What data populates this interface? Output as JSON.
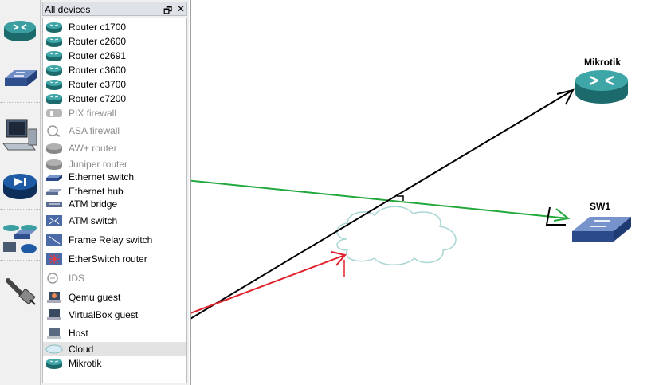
{
  "dock": {
    "title": "All devices",
    "float_glyph": "🗗",
    "close_glyph": "✕"
  },
  "toolbar": {
    "tools": [
      {
        "name": "routers-tool",
        "icon": "router-icon"
      },
      {
        "name": "switches-tool",
        "icon": "switch-icon"
      },
      {
        "name": "end-devices-tool",
        "icon": "computer-icon"
      },
      {
        "name": "security-devices-tool",
        "icon": "firewall-icon"
      },
      {
        "name": "all-devices-tool",
        "icon": "devices-group-icon"
      },
      {
        "name": "add-link-tool",
        "icon": "cable-icon"
      }
    ]
  },
  "devices": [
    {
      "label": "Router c1700",
      "icon": "router",
      "enabled": true
    },
    {
      "label": "Router c2600",
      "icon": "router",
      "enabled": true
    },
    {
      "label": "Router c2691",
      "icon": "router",
      "enabled": true
    },
    {
      "label": "Router c3600",
      "icon": "router",
      "enabled": true
    },
    {
      "label": "Router c3700",
      "icon": "router",
      "enabled": true
    },
    {
      "label": "Router c7200",
      "icon": "router",
      "enabled": true
    },
    {
      "label": "PIX firewall",
      "icon": "firewall",
      "enabled": false
    },
    {
      "label": "ASA firewall",
      "icon": "asa",
      "enabled": false
    },
    {
      "label": "AW+ router",
      "icon": "router-gray",
      "enabled": false
    },
    {
      "label": "Juniper router",
      "icon": "router-gray",
      "enabled": false
    },
    {
      "label": "Ethernet switch",
      "icon": "switch",
      "enabled": true
    },
    {
      "label": "Ethernet hub",
      "icon": "hub",
      "enabled": true
    },
    {
      "label": "ATM bridge",
      "icon": "bridge",
      "enabled": true
    },
    {
      "label": "ATM switch",
      "icon": "atm",
      "enabled": true
    },
    {
      "label": "Frame Relay switch",
      "icon": "frame-relay",
      "enabled": true
    },
    {
      "label": "EtherSwitch router",
      "icon": "etherswitch",
      "enabled": true
    },
    {
      "label": "IDS",
      "icon": "ids",
      "enabled": false
    },
    {
      "label": "Qemu guest",
      "icon": "qemu",
      "enabled": true
    },
    {
      "label": "VirtualBox guest",
      "icon": "vbox",
      "enabled": true
    },
    {
      "label": "Host",
      "icon": "host",
      "enabled": true
    },
    {
      "label": "Cloud",
      "icon": "cloud",
      "enabled": true,
      "selected": true
    },
    {
      "label": "Mikrotik",
      "icon": "router",
      "enabled": true
    }
  ],
  "scene": {
    "nodes": [
      {
        "name": "mikrotik-node",
        "label": "Mikrotik",
        "kind": "router"
      },
      {
        "name": "sw1-node",
        "label": "SW1",
        "kind": "switch"
      },
      {
        "name": "cloud-node",
        "label": "",
        "kind": "cloud"
      }
    ],
    "annotation_colors": {
      "black": "#000000",
      "green": "#22a83a",
      "red": "#e0202a"
    }
  },
  "colors": {
    "router": "#2f8f91",
    "switch": "#3a5b9a",
    "panel": "#f0f0f0"
  }
}
